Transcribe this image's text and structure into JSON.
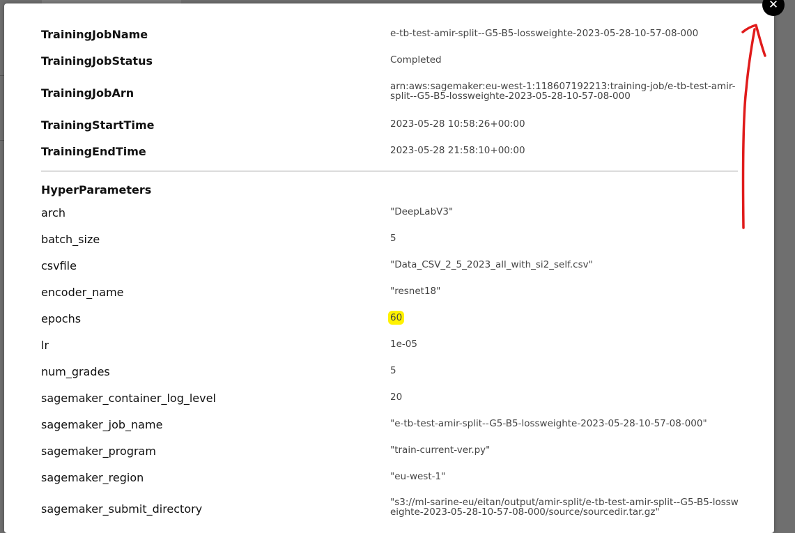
{
  "close_label": "✕",
  "job": [
    {
      "key": "TrainingJobName",
      "value": "e-tb-test-amir-split--G5-B5-lossweighte-2023-05-28-10-57-08-000"
    },
    {
      "key": "TrainingJobStatus",
      "value": "Completed"
    },
    {
      "key": "TrainingJobArn",
      "value": "arn:aws:sagemaker:eu-west-1:118607192213:training-job/e-tb-test-amir-split--G5-B5-lossweighte-2023-05-28-10-57-08-000"
    },
    {
      "key": "TrainingStartTime",
      "value": "2023-05-28 10:58:26+00:00"
    },
    {
      "key": "TrainingEndTime",
      "value": "2023-05-28 21:58:10+00:00"
    }
  ],
  "hyper_title": "HyperParameters",
  "hyper": [
    {
      "key": "arch",
      "value": "\"DeepLabV3\""
    },
    {
      "key": "batch_size",
      "value": "5"
    },
    {
      "key": "csvfile",
      "value": "\"Data_CSV_2_5_2023_all_with_si2_self.csv\""
    },
    {
      "key": "encoder_name",
      "value": "\"resnet18\""
    },
    {
      "key": "epochs",
      "value": "60"
    },
    {
      "key": "lr",
      "value": "1e-05"
    },
    {
      "key": "num_grades",
      "value": "5"
    },
    {
      "key": "sagemaker_container_log_level",
      "value": "20"
    },
    {
      "key": "sagemaker_job_name",
      "value": "\"e-tb-test-amir-split--G5-B5-lossweighte-2023-05-28-10-57-08-000\""
    },
    {
      "key": "sagemaker_program",
      "value": "\"train-current-ver.py\""
    },
    {
      "key": "sagemaker_region",
      "value": "\"eu-west-1\""
    },
    {
      "key": "sagemaker_submit_directory",
      "value": "\"s3://ml-sarine-eu/eitan/output/amir-split/e-tb-test-amir-split--G5-B5-lossweighte-2023-05-28-10-57-08-000/source/sourcedir.tar.gz\""
    }
  ],
  "colors": {
    "highlight": "#fff200",
    "annotation_arrow": "#e01b1b"
  },
  "icons": {
    "close": "close-icon",
    "annotation": "red-arrow-annotation"
  }
}
